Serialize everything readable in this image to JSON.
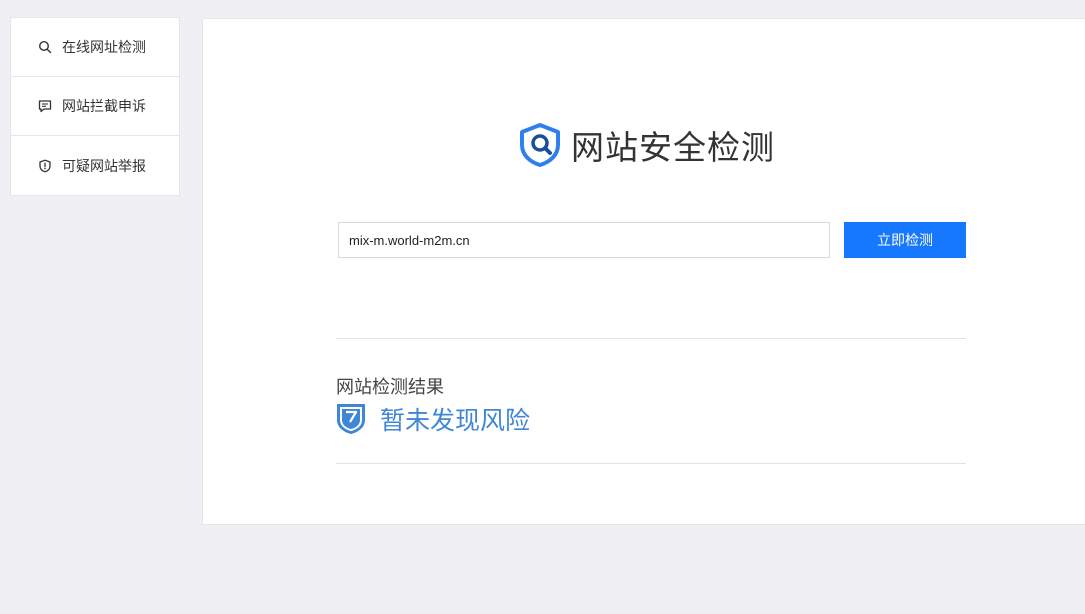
{
  "sidebar": {
    "items": [
      {
        "label": "在线网址检测",
        "icon": "search-icon"
      },
      {
        "label": "网站拦截申诉",
        "icon": "message-icon"
      },
      {
        "label": "可疑网站举报",
        "icon": "shield-alert-icon"
      }
    ]
  },
  "main": {
    "brand_title": "网站安全检测",
    "brand_icon": "shield-search-icon",
    "url_input_value": "mix-m.world-m2m.cn",
    "check_button_label": "立即检测",
    "result_label": "网站检测结果",
    "result_status": "暂未发现风险",
    "result_icon": "shield-check-icon"
  },
  "colors": {
    "accent": "#1677ff",
    "result_text": "#3f86d6",
    "background": "#f0f0f4"
  }
}
